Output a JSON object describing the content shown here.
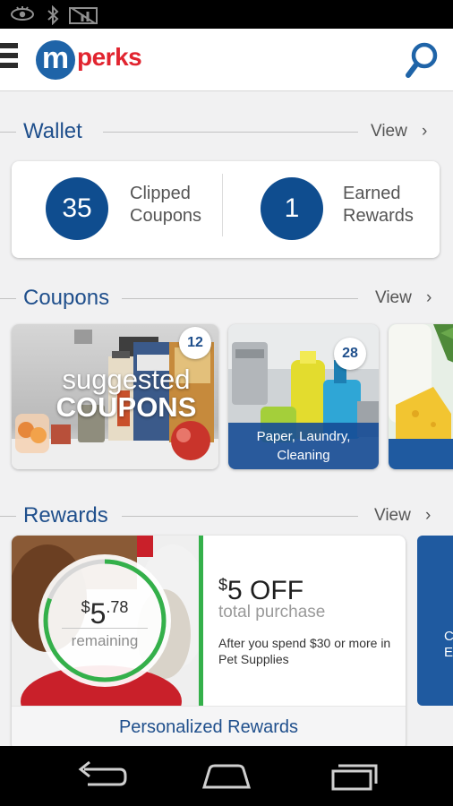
{
  "status_bar": {
    "icons": [
      "eye-icon",
      "bluetooth-icon",
      "no-signal-icon"
    ]
  },
  "header": {
    "logo_letter": "m",
    "logo_text": "perks",
    "brand_colors": {
      "blue": "#1f64a8",
      "red": "#e1242f"
    },
    "icons": [
      "menu-icon",
      "search-icon"
    ]
  },
  "wallet": {
    "title": "Wallet",
    "view_label": "View",
    "chevron": "›",
    "clipped_count": "35",
    "clipped_label_1": "Clipped",
    "clipped_label_2": "Coupons",
    "earned_count": "1",
    "earned_label_1": "Earned",
    "earned_label_2": "Rewards"
  },
  "coupons": {
    "title": "Coupons",
    "view_label": "View",
    "chevron": "›",
    "tiles": [
      {
        "badge": "12",
        "line_1": "suggested",
        "line_2": "COUPONS"
      },
      {
        "badge": "28",
        "caption_1": "Paper, Laundry,",
        "caption_2": "Cleaning"
      }
    ]
  },
  "rewards": {
    "title": "Rewards",
    "view_label": "View",
    "chevron": "›",
    "card": {
      "currency": "$",
      "remaining_whole": "5",
      "remaining_cents": ".78",
      "remaining_fraction": 0.81,
      "remaining_label": "remaining",
      "offer_amount": "5 OFF",
      "offer_sub": "total purchase",
      "offer_desc": "After you spend $30 or more in Pet Supplies",
      "footer": "Personalized Rewards",
      "accent": "#34b04a"
    },
    "next_card_fragment": [
      "C",
      "E"
    ]
  },
  "nav_bar": {
    "icons": [
      "back-icon",
      "home-icon",
      "recent-apps-icon"
    ]
  }
}
